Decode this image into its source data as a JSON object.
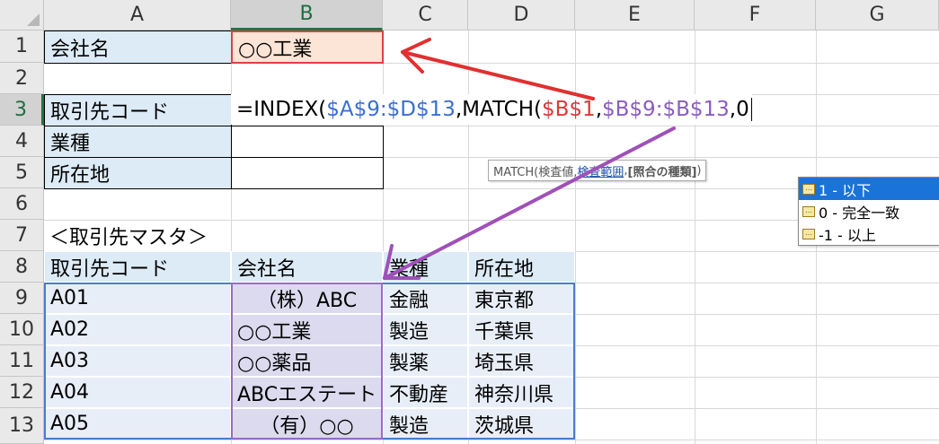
{
  "columns": [
    "A",
    "B",
    "C",
    "D",
    "E",
    "F",
    "G"
  ],
  "rows": [
    "1",
    "2",
    "3",
    "4",
    "5",
    "6",
    "7",
    "8",
    "9",
    "10",
    "11",
    "12",
    "13"
  ],
  "top_cells": {
    "a1": "会社名",
    "b1": "○○工業",
    "a3": "取引先コード",
    "a4": "業種",
    "a5": "所在地",
    "a7": "＜取引先マスタ＞"
  },
  "formula": {
    "p1": "=INDEX(",
    "p2": "$A$9:$D$13",
    "p3": ",MATCH(",
    "p4": "$B$1",
    "p5": ",",
    "p6": "$B$9:$B$13",
    "p7": ",0"
  },
  "tooltip": {
    "fn": "MATCH(検査値, ",
    "range": "検査範囲",
    "sep": ", ",
    "type": "[照合の種類]",
    "close": ")"
  },
  "autocomplete": [
    {
      "label": "1 - 以下",
      "icon": "match-type-icon"
    },
    {
      "label": "0 - 完全一致",
      "icon": "match-type-icon"
    },
    {
      "label": "-1 - 以上",
      "icon": "match-type-icon"
    }
  ],
  "table": {
    "headers": [
      "取引先コード",
      "会社名",
      "業種",
      "所在地"
    ],
    "rows": [
      [
        "A01",
        "（株）ABC",
        "金融",
        "東京都"
      ],
      [
        "A02",
        "○○工業",
        "製造",
        "千葉県"
      ],
      [
        "A03",
        "○○薬品",
        "製薬",
        "埼玉県"
      ],
      [
        "A04",
        "ABCエステート",
        "不動産",
        "神奈川県"
      ],
      [
        "A05",
        "（有）○○",
        "製造",
        "茨城県"
      ]
    ]
  },
  "colors": {
    "accent_green": "#217346",
    "arrow_red": "#e03030",
    "arrow_purple": "#a050b8",
    "formula_blue": "#3a6fd0"
  }
}
